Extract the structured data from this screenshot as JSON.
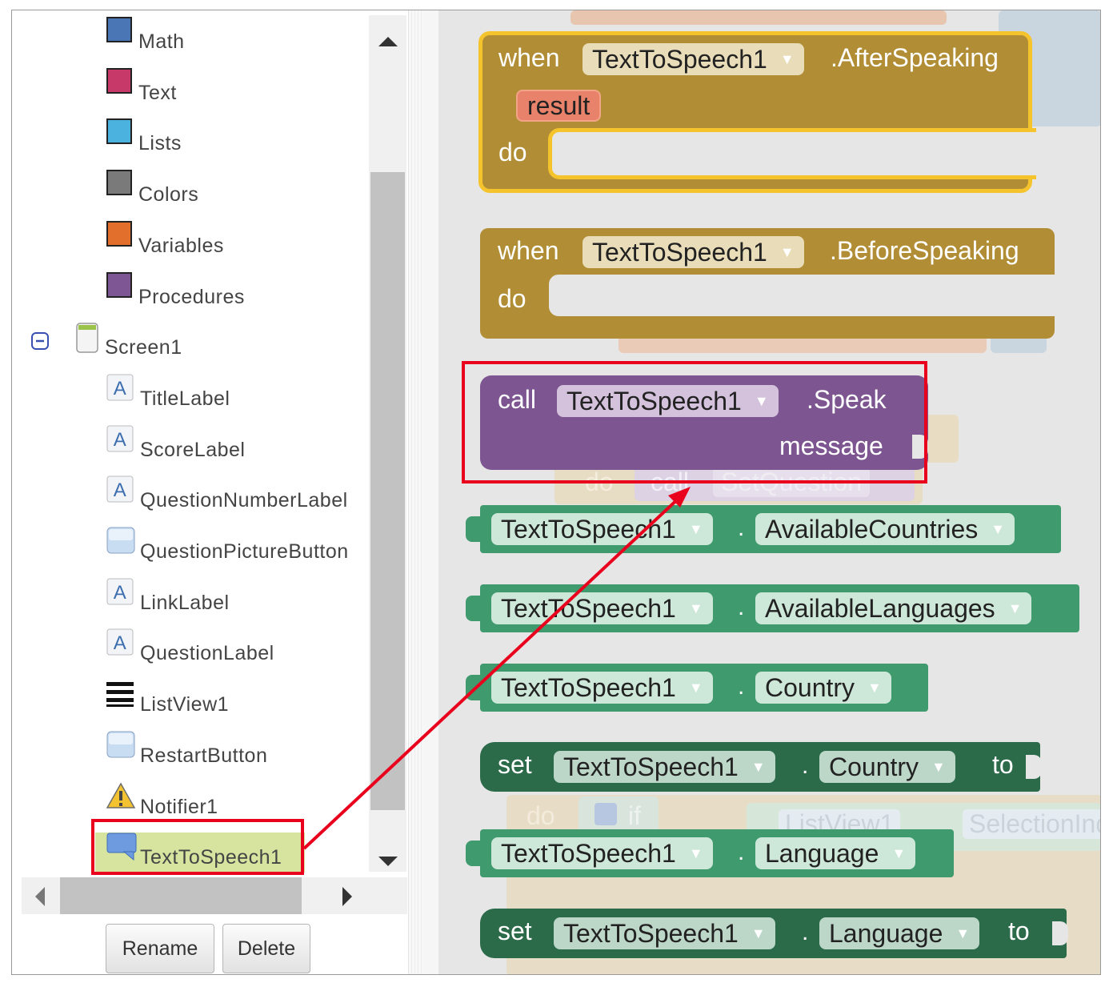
{
  "palette": {
    "builtins": [
      {
        "label": "Math",
        "color": "#4a76b5"
      },
      {
        "label": "Text",
        "color": "#c63969"
      },
      {
        "label": "Lists",
        "color": "#4bb2e0"
      },
      {
        "label": "Colors",
        "color": "#7a7a7a"
      },
      {
        "label": "Variables",
        "color": "#e36f2d"
      },
      {
        "label": "Procedures",
        "color": "#7e5694"
      }
    ],
    "screen": {
      "collapse_icon": "minus-square-icon",
      "label": "Screen1"
    },
    "components": [
      {
        "label": "TitleLabel",
        "icon": "label-icon"
      },
      {
        "label": "ScoreLabel",
        "icon": "label-icon"
      },
      {
        "label": "QuestionNumberLabel",
        "icon": "label-icon"
      },
      {
        "label": "QuestionPictureButton",
        "icon": "button-icon"
      },
      {
        "label": "LinkLabel",
        "icon": "label-icon"
      },
      {
        "label": "QuestionLabel",
        "icon": "label-icon"
      },
      {
        "label": "ListView1",
        "icon": "listview-icon"
      },
      {
        "label": "RestartButton",
        "icon": "button-icon"
      },
      {
        "label": "Notifier1",
        "icon": "warning-icon"
      },
      {
        "label": "TextToSpeech1",
        "icon": "speech-bubble-icon",
        "selected": true
      }
    ],
    "buttons": {
      "rename": "Rename",
      "delete": "Delete"
    }
  },
  "workspace": {
    "event_after": {
      "when": "when",
      "component": "TextToSpeech1",
      "event": ".AfterSpeaking",
      "param": "result",
      "do": "do"
    },
    "event_before": {
      "when": "when",
      "component": "TextToSpeech1",
      "event": ".BeforeSpeaking",
      "do": "do"
    },
    "call_speak": {
      "call": "call",
      "component": "TextToSpeech1",
      "method": ".Speak",
      "arg": "message"
    },
    "getters": [
      {
        "component": "TextToSpeech1",
        "dot": ".",
        "property": "AvailableCountries"
      },
      {
        "component": "TextToSpeech1",
        "dot": ".",
        "property": "AvailableLanguages"
      },
      {
        "component": "TextToSpeech1",
        "dot": ".",
        "property": "Country"
      },
      {
        "component": "TextToSpeech1",
        "dot": ".",
        "property": "Language"
      }
    ],
    "setters": [
      {
        "set": "set",
        "component": "TextToSpeech1",
        "dot": ".",
        "property": "Country",
        "to": "to"
      },
      {
        "set": "set",
        "component": "TextToSpeech1",
        "dot": ".",
        "property": "Language",
        "to": "to"
      }
    ],
    "background_blocks": {
      "do1": "do",
      "call": "call",
      "proc": "SetQuestion",
      "do2": "do",
      "if": "if",
      "listview": "ListView1",
      "selection": "SelectionIndex"
    }
  },
  "colors": {
    "event": "#b18e35",
    "event_border": "#f5c32c",
    "procedure": "#7d5590",
    "getter": "#3f9a6e",
    "setter": "#2b6b4a",
    "param": "#e8826a",
    "highlight": "#e8001c",
    "selected_bg": "#d7e4a0"
  }
}
